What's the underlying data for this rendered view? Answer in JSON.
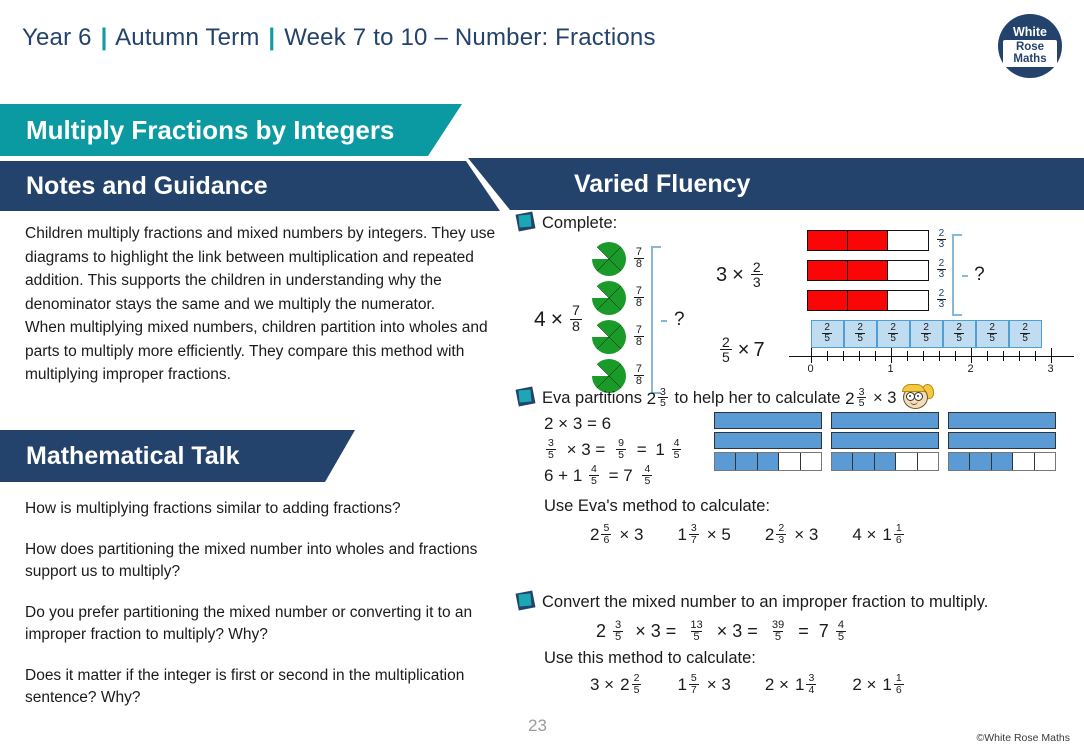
{
  "header": {
    "year": "Year 6",
    "term": "Autumn Term",
    "week": "Week 7 to 10 – Number: Fractions",
    "separator": "|"
  },
  "logo": {
    "line1": "White",
    "line2": "Rose",
    "line3": "Maths"
  },
  "banners": {
    "title": "Multiply Fractions by Integers",
    "notes": "Notes and Guidance",
    "math_talk": "Mathematical Talk",
    "varied_fluency": "Varied Fluency"
  },
  "notes_text": "Children multiply fractions and mixed numbers by integers. They use diagrams to highlight the link between multiplication and repeated addition. This supports the children in understanding why the denominator stays the same and we multiply the numerator.\nWhen multiplying mixed numbers, children partition into wholes and parts to multiply more efficiently. They compare this method with multiplying improper fractions.",
  "math_talk_questions": [
    "How is multiplying fractions similar to adding fractions?",
    "How does partitioning the mixed number into wholes and fractions support us to multiply?",
    "Do you prefer partitioning the mixed number or converting it to an improper fraction to multiply? Why?",
    "Does it matter if the integer is first or second in the multiplication sentence? Why?"
  ],
  "task1": {
    "heading": "Complete:",
    "expr1": {
      "whole": "4",
      "times": "×",
      "num": "7",
      "den": "8"
    },
    "pie_labels": [
      {
        "num": "7",
        "den": "8"
      },
      {
        "num": "7",
        "den": "8"
      },
      {
        "num": "7",
        "den": "8"
      },
      {
        "num": "7",
        "den": "8"
      }
    ],
    "question_mark": "?",
    "expr2": {
      "whole": "3",
      "times": "×",
      "num": "2",
      "den": "3"
    },
    "bar_labels": [
      {
        "num": "2",
        "den": "3"
      },
      {
        "num": "2",
        "den": "3"
      },
      {
        "num": "2",
        "den": "3"
      }
    ],
    "expr3": {
      "num": "2",
      "den": "5",
      "times": "×",
      "whole": "7"
    },
    "numberline_box_label": {
      "num": "2",
      "den": "5"
    },
    "numberline_ticks": [
      "0",
      "1",
      "2",
      "3"
    ]
  },
  "task2": {
    "heading_part1": "Eva partitions",
    "heading_mixed1": {
      "whole": "2",
      "num": "3",
      "den": "5"
    },
    "heading_part2": "to help her to calculate",
    "heading_mixed2": {
      "whole": "2",
      "num": "3",
      "den": "5"
    },
    "heading_times": "× 3",
    "steps": [
      {
        "type": "plain",
        "text": "2 × 3 = 6"
      },
      {
        "type": "fraction_line",
        "parts": [
          "3/5",
          "× 3 =",
          "9/5",
          "= 1 4/5"
        ]
      },
      {
        "type": "plain2",
        "text": "6 + 1 4/5 = 7 4/5"
      }
    ],
    "step1": "2 × 3 = 6",
    "step2_f1_n": "3",
    "step2_f1_d": "5",
    "step2_mid": "× 3 =",
    "step2_f2_n": "9",
    "step2_f2_d": "5",
    "step2_eq": "=",
    "step2_whole": "1",
    "step2_f3_n": "4",
    "step2_f3_d": "5",
    "step3_lead": "6 + 1",
    "step3_f1_n": "4",
    "step3_f1_d": "5",
    "step3_eq": "= 7",
    "step3_f2_n": "4",
    "step3_f2_d": "5",
    "use_method": "Use Eva's method to calculate:",
    "exercises": [
      {
        "whole": "2",
        "num": "5",
        "den": "6",
        "op": "× 3",
        "order": "mixed-first"
      },
      {
        "whole": "1",
        "num": "3",
        "den": "7",
        "op": "× 5",
        "order": "mixed-first"
      },
      {
        "whole": "2",
        "num": "2",
        "den": "3",
        "op": "× 3",
        "order": "mixed-first"
      },
      {
        "whole": "1",
        "num": "1",
        "den": "6",
        "op": "4 ×",
        "order": "int-first"
      }
    ]
  },
  "task3": {
    "heading": "Convert the mixed number to an improper fraction to multiply.",
    "equation": {
      "m_whole": "2",
      "m_num": "3",
      "m_den": "5",
      "times1": "× 3 =",
      "i_num": "13",
      "i_den": "5",
      "times2": "× 3 =",
      "r_num": "39",
      "r_den": "5",
      "equals": "=",
      "f_whole": "7",
      "f_num": "4",
      "f_den": "5"
    },
    "use_method": "Use this method to calculate:",
    "exercises": [
      {
        "int": "3 ×",
        "whole": "2",
        "num": "2",
        "den": "5",
        "order": "int-first"
      },
      {
        "whole": "1",
        "num": "5",
        "den": "7",
        "op": "× 3",
        "order": "mixed-first"
      },
      {
        "int": "2 ×",
        "whole": "1",
        "num": "3",
        "den": "4",
        "order": "int-first"
      },
      {
        "int": "2 ×",
        "whole": "1",
        "num": "1",
        "den": "6",
        "order": "int-first"
      }
    ]
  },
  "footer": {
    "page_number": "23",
    "copyright": "©White Rose Maths"
  },
  "colors": {
    "teal": "#0b99a2",
    "navy": "#24436c",
    "red": "#fb0606",
    "blue": "#5b9bd5",
    "green": "#1a9a28",
    "lightblue": "#bfdcf0"
  }
}
